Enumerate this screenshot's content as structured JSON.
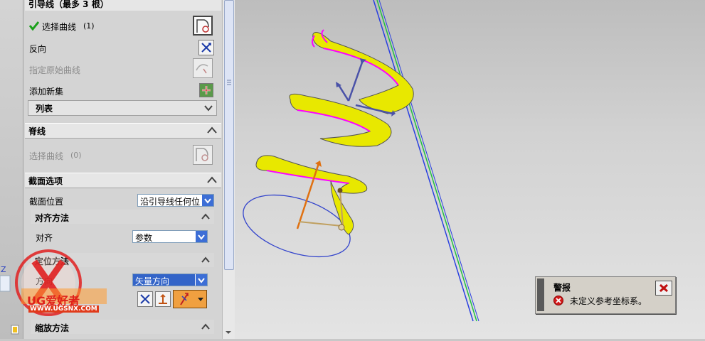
{
  "panel": {
    "guide_section": {
      "title": "引导线（最多 3 根）",
      "select_curve_label": "选择曲线",
      "select_curve_count": "(1)",
      "reverse_label": "反向",
      "specify_origin_label": "指定原始曲线",
      "add_set_label": "添加新集",
      "list_label": "列表"
    },
    "spine_section": {
      "title": "脊线",
      "select_curve_label": "选择曲线",
      "select_curve_count": "(0)"
    },
    "section_options": {
      "title": "截面选项",
      "position_label": "截面位置",
      "position_value": "沿引导线任何位",
      "align": {
        "title": "对齐方法",
        "label": "对齐",
        "value": "参数"
      },
      "orient": {
        "title": "定位方法",
        "label": "方向",
        "value": "矢量方向"
      },
      "next_title": "缩放方法"
    }
  },
  "alert": {
    "title": "警报",
    "message": "未定义参考坐标系。"
  },
  "watermark": {
    "brand": "UG爱好者",
    "url": "WWW.UGSNX.COM"
  },
  "colors": {
    "helix_fill": "#e8e800",
    "helix_edge": "#ff00ff",
    "circle": "#3344cc",
    "axis_blue": "#2a40e0",
    "axis_green": "#22c040",
    "vector_orange": "#e07010",
    "vector_blue": "#4a52a8"
  },
  "icons": {
    "check": "check-icon",
    "select_curve": "curve-select-icon",
    "reverse": "reverse-direction-icon",
    "add_set": "add-set-icon",
    "error": "error-icon",
    "close": "close-icon"
  }
}
